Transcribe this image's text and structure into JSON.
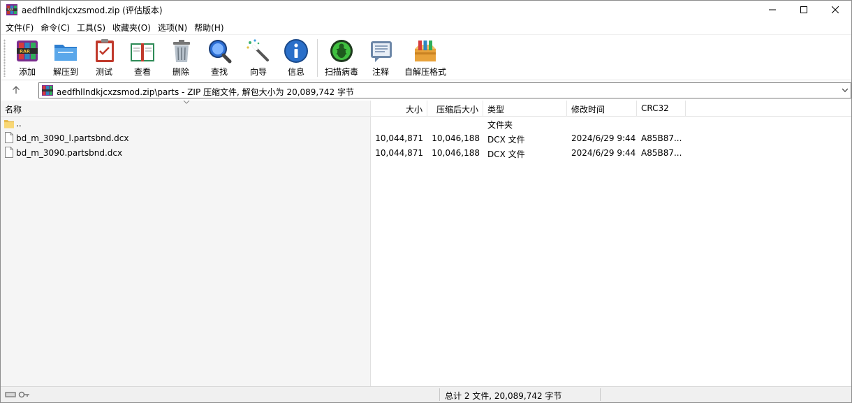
{
  "window": {
    "title": "aedfhllndkjcxzsmod.zip (评估版本)",
    "minimize_glyph": "minimize-icon",
    "maximize_glyph": "maximize-icon",
    "close_glyph": "close-icon"
  },
  "menu": [
    {
      "label": "文件(F)"
    },
    {
      "label": "命令(C)"
    },
    {
      "label": "工具(S)"
    },
    {
      "label": "收藏夹(O)"
    },
    {
      "label": "选项(N)"
    },
    {
      "label": "帮助(H)"
    }
  ],
  "toolbar": {
    "add": "添加",
    "extract": "解压到",
    "test": "测试",
    "view": "查看",
    "delete": "删除",
    "find": "查找",
    "wizard": "向导",
    "info": "信息",
    "scan": "扫描病毒",
    "comment": "注释",
    "sfx": "自解压格式"
  },
  "address": {
    "path": "aedfhllndkjcxzsmod.zip\\parts - ZIP 压缩文件, 解包大小为 20,089,742 字节"
  },
  "columns": {
    "name": "名称",
    "size": "大小",
    "packed": "压缩后大小",
    "type": "类型",
    "modified": "修改时间",
    "crc": "CRC32"
  },
  "rows": [
    {
      "name": "..",
      "size": "",
      "packed": "",
      "type": "文件夹",
      "modified": "",
      "crc": "",
      "icon": "folder-icon"
    },
    {
      "name": "bd_m_3090_l.partsbnd.dcx",
      "size": "10,044,871",
      "packed": "10,046,188",
      "type": "DCX 文件",
      "modified": "2024/6/29 9:44",
      "crc": "A85B87...",
      "icon": "file-icon"
    },
    {
      "name": "bd_m_3090.partsbnd.dcx",
      "size": "10,044,871",
      "packed": "10,046,188",
      "type": "DCX 文件",
      "modified": "2024/6/29 9:44",
      "crc": "A85B87...",
      "icon": "file-icon"
    }
  ],
  "status": {
    "summary": "总计 2 文件, 20,089,742 字节"
  },
  "colors": {
    "name_pane_bg": "#f5f5f5",
    "statusbar_bg": "#f0f0f0",
    "folder_yellow": "#f8d775"
  }
}
